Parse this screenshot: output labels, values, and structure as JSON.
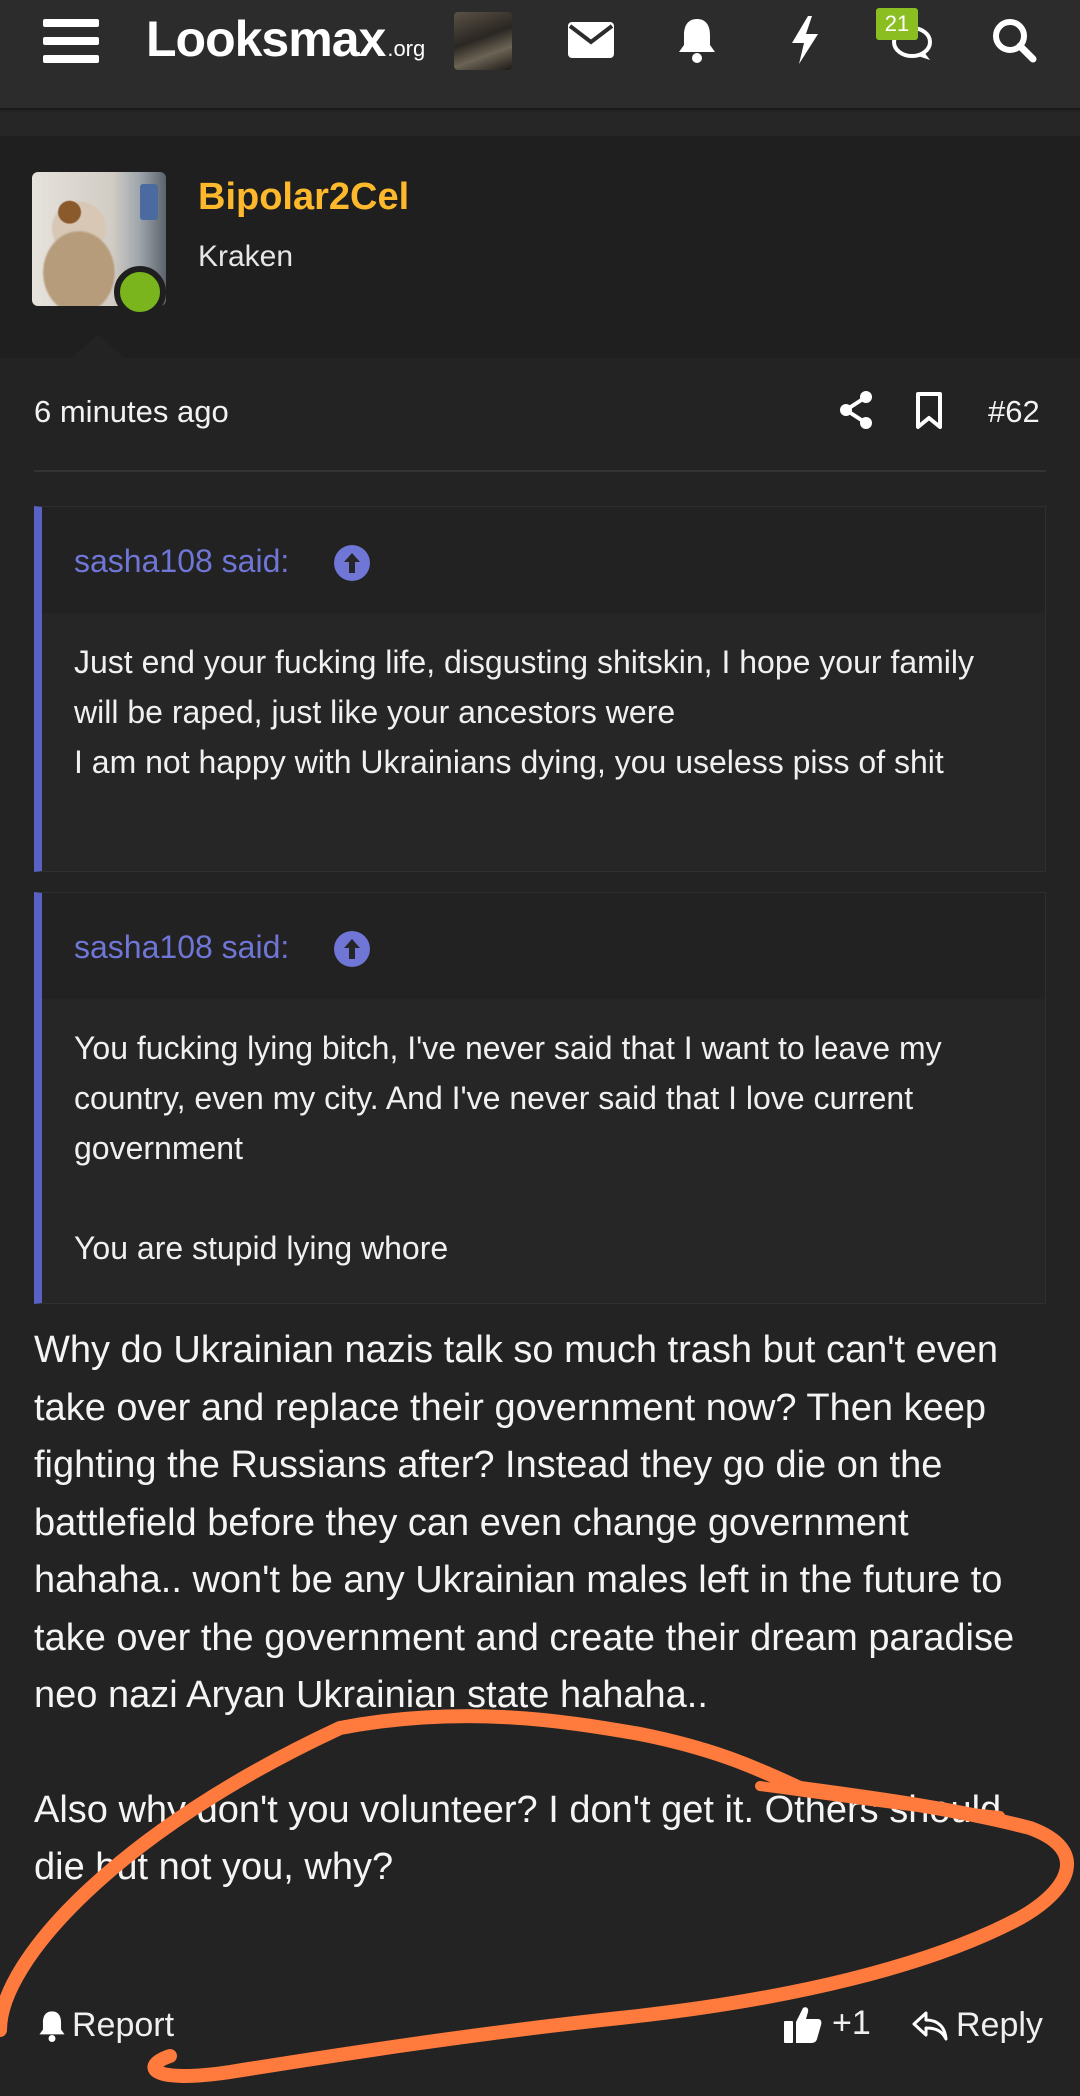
{
  "nav": {
    "logo_main": "Looksmax",
    "logo_tld": ".org",
    "icons": [
      "menu-icon",
      "avatar",
      "mail-icon",
      "bell-icon",
      "bolt-icon",
      "chat-icon",
      "search-icon"
    ],
    "chat_badge": "21"
  },
  "post": {
    "username": "Bipolar2Cel",
    "user_title": "Kraken",
    "username_color": "#fdb92b",
    "online_color": "#7ab51d",
    "timestamp": "6 minutes ago",
    "number": "#62",
    "quotes": [
      {
        "author": "sasha108 said:",
        "lines": [
          "Just end your fucking life, disgusting shitskin, I hope your family will be raped, just like your ancestors were",
          "I am not happy with Ukrainians dying, you useless piss of shit"
        ]
      },
      {
        "author": "sasha108 said:",
        "para1": "You fucking lying bitch, I've never said that I want to leave my country, even my city. And I've never said that I love current government",
        "para2": "You are stupid lying whore"
      }
    ],
    "message": {
      "para1": "Why do Ukrainian nazis talk so much trash but can't even take over and replace their government now? Then keep fighting the Russians after? Instead they go die on the battlefield before they can even change government hahaha.. won't be any Ukrainian males left in the future to take over the government and create their dream paradise neo nazi Aryan Ukrainian state hahaha..",
      "para2": "Also why don't you volunteer? I don't get it. Others should die but not you, why?"
    },
    "actions": {
      "report": "Report",
      "like_count": "+1",
      "reply": "Reply"
    }
  },
  "colors": {
    "quote_accent": "#5a61c4",
    "quote_author": "#6f76d6",
    "scribble": "#ff7a3d"
  }
}
